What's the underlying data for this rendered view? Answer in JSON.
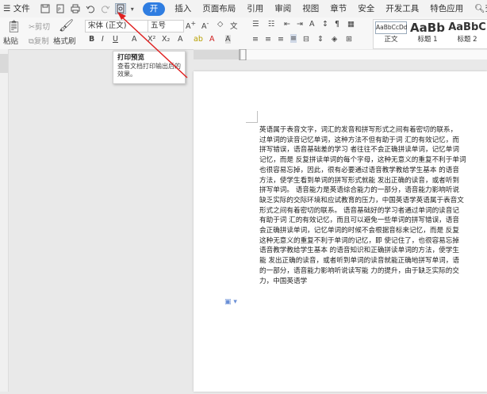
{
  "menubar": {
    "file": "文件",
    "start": "开始",
    "items": [
      "插入",
      "页面布局",
      "引用",
      "审阅",
      "视图",
      "章节",
      "安全",
      "开发工具",
      "特色应用"
    ],
    "search": "查找",
    "accent": "#2f7de1"
  },
  "ribbon": {
    "cut": "剪切",
    "paste": "粘贴",
    "copy": "复制",
    "format_painter": "格式刷",
    "font_name": "宋体 (正文)",
    "font_size": "五号",
    "styles": [
      {
        "preview": "AaBbCcDd",
        "name": "正文"
      },
      {
        "preview": "AaBb",
        "name": "标题 1"
      },
      {
        "preview": "AaBbC",
        "name": "标题 2"
      }
    ]
  },
  "tooltip": {
    "title": "打印预览",
    "desc_line1": "查看文档打印输出后的",
    "desc_line2": "效果。",
    "arrow_color": "#e02020"
  },
  "document": {
    "lines": [
      "英语属于表音文字，词汇的发音和拼写形式之间有着密切的联系，",
      "过单词的读音记忆单词，这种方法不但有助于词 汇的有效记忆，而",
      "拼写错误，语音基础差的学习 者往往不会正确拼读单词，记忆单词",
      "记忆，而是 反复拼读单词的每个字母，这种无意义的重复不利于单词",
      "也很容易忘掉，因此，很有必要通过语音教学教给学生基本 的语音",
      "方法，使学生看到单词的拼写形式就能 发出正确的读音，或者听到",
      "拼写单词。 语音能力是英语综合能力的一部分，语音能力影响听说",
      "缺乏实际的交际环境和应试教育的压力，中国英语学英语属于表音文",
      "形式之间有着密切的联系。 语音基础好的学习者通过单词的读音记",
      "有助于词 汇的有效记忆，而且可以避免一些单词的拼写错误，语音",
      "会正确拼读单词，记忆单词的时候不会根据音标来记忆，而是 反复",
      "这种无意义的重复不利于单词的记忆，即 使记住了，也很容易忘掉",
      "语音教学教给学生基本 的语音知识和正确拼读单词的方法，使学生",
      "能 发出正确的读音，或者听到单词的读音就能正确地拼写单词，语",
      "的一部分，语音能力影响听说读写能 力的提升，由于缺乏实际的交",
      "力，中国英语学"
    ]
  }
}
